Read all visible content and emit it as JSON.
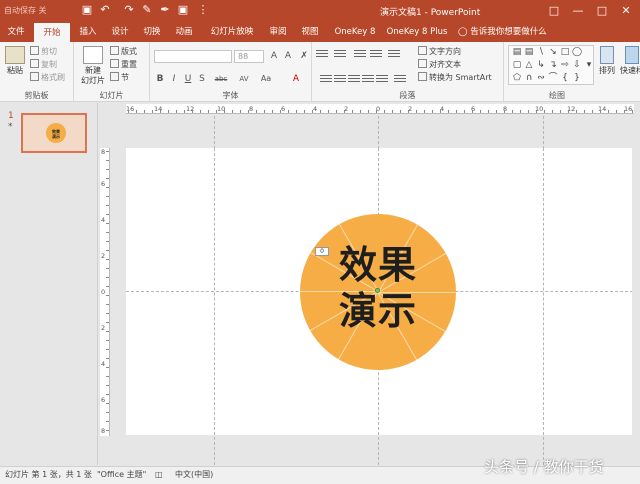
{
  "titlebar": {
    "autosave": "自动保存",
    "autosave_state": "关",
    "doc_title": "演示文稿1  -  PowerPoint",
    "icons": [
      "save-icon",
      "undo-icon",
      "redo-icon",
      "format-painter-icon",
      "pen-icon",
      "slideshow-icon",
      "more-icon"
    ]
  },
  "tabs": [
    "文件",
    "开始",
    "插入",
    "设计",
    "切换",
    "动画",
    "幻灯片放映",
    "审阅",
    "视图",
    "OneKey 8",
    "OneKey 8 Plus"
  ],
  "active_tab": "开始",
  "tell_me": "告诉我你想要做什么",
  "ribbon": {
    "clipboard": {
      "paste": "粘贴",
      "cut": "剪切",
      "copy": "复制",
      "format_painter": "格式刷",
      "label": "剪贴板"
    },
    "slides": {
      "new_slide_line1": "新建",
      "new_slide_line2": "幻灯片",
      "layout": "版式",
      "reset": "重置",
      "section": "节",
      "label": "幻灯片"
    },
    "font": {
      "font_name": "",
      "font_size": "88",
      "label": "字体",
      "buttons": [
        "B",
        "I",
        "U",
        "S",
        "abc",
        "AV",
        "Aa",
        "A"
      ]
    },
    "paragraph": {
      "text_direction": "文字方向",
      "align_text": "对齐文本",
      "smartart": "转换为 SmartArt",
      "label": "段落"
    },
    "drawing": {
      "arrange": "排列",
      "quick_styles": "快速样",
      "label": "绘图"
    }
  },
  "thumbnail": {
    "number": "1",
    "star": "*",
    "text_line1": "效果",
    "text_line2": "演示"
  },
  "ruler": {
    "h_labels": [
      "16",
      "14",
      "12",
      "10",
      "8",
      "6",
      "4",
      "2",
      "0",
      "2",
      "4",
      "6",
      "8",
      "10",
      "12",
      "14",
      "16"
    ],
    "v_labels": [
      "8",
      "6",
      "4",
      "2",
      "0",
      "2",
      "4",
      "6",
      "8"
    ]
  },
  "slide": {
    "text_line1": "效果",
    "text_line2": "演示",
    "value_tag": "0",
    "colors": {
      "circle": "#f6ad45",
      "text": "#1e1e1e"
    }
  },
  "statusbar": {
    "slide_info": "幻灯片 第 1 张，共 1 张",
    "theme": "\"Office 主题\"",
    "language": "中文(中国)"
  },
  "watermark": "头条号 / 教你干货",
  "colors": {
    "accent": "#b7472a"
  }
}
